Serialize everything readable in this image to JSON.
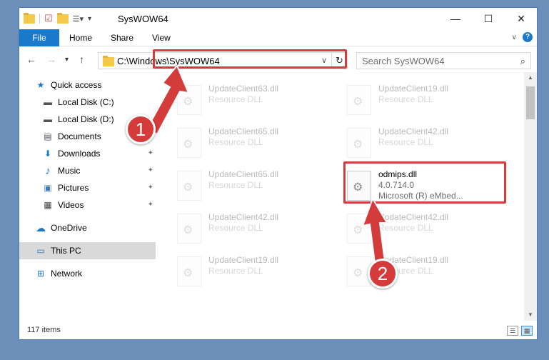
{
  "window": {
    "title": "SysWOW64",
    "minimize": "—",
    "maximize": "☐",
    "close": "✕"
  },
  "ribbon": {
    "tabs": [
      "File",
      "Home",
      "Share",
      "View"
    ],
    "expand_icon": "chevron-down-icon",
    "help": "?"
  },
  "nav": {
    "back": "←",
    "forward": "→",
    "recent": "▾",
    "up": "↑",
    "address": "C:\\Windows\\SysWOW64",
    "address_dropdown": "∨",
    "refresh": "↻",
    "search_placeholder": "Search SysWOW64",
    "search_icon": "⌕"
  },
  "sidebar": {
    "items": [
      {
        "label": "Quick access",
        "icon": "star-icon",
        "glyph": "★",
        "color": "#1979ca"
      },
      {
        "label": "Local Disk (C:)",
        "icon": "drive-icon",
        "glyph": "▬",
        "color": "#555"
      },
      {
        "label": "Local Disk (D:)",
        "icon": "drive-icon",
        "glyph": "▬",
        "color": "#555"
      },
      {
        "label": "Documents",
        "icon": "documents-icon",
        "glyph": "▤",
        "color": "#556"
      },
      {
        "label": "Downloads",
        "icon": "download-icon",
        "glyph": "⬇",
        "color": "#1979ca"
      },
      {
        "label": "Music",
        "icon": "music-icon",
        "glyph": "♪",
        "color": "#1979ca"
      },
      {
        "label": "Pictures",
        "icon": "pictures-icon",
        "glyph": "▣",
        "color": "#3a7bbf"
      },
      {
        "label": "Videos",
        "icon": "videos-icon",
        "glyph": "▦",
        "color": "#444"
      },
      {
        "label": "OneDrive",
        "icon": "cloud-icon",
        "glyph": "☁",
        "color": "#1979ca"
      },
      {
        "label": "This PC",
        "icon": "computer-icon",
        "glyph": "▭",
        "color": "#1979ca"
      },
      {
        "label": "Network",
        "icon": "network-icon",
        "glyph": "⊞",
        "color": "#1979ca"
      }
    ],
    "pin_glyph": "📌"
  },
  "files": [
    {
      "name": "UpdateClient63.dll",
      "desc": "Resource DLL"
    },
    {
      "name": "UpdateClient19.dll",
      "desc": "Resource DLL"
    },
    {
      "name": "UpdateClient65.dll",
      "desc": "Resource DLL"
    },
    {
      "name": "UpdateClient42.dll",
      "desc": "Resource DLL"
    },
    {
      "name": "UpdateClient65.dll",
      "desc": "Resource DLL"
    },
    {
      "name": "UpdateClient42.dll",
      "desc": "Resource DLL"
    },
    {
      "name": "UpdateClient42.dll",
      "desc": "Resource DLL"
    },
    {
      "name": "UpdateClient19.dll",
      "desc": "Resource DLL"
    },
    {
      "name": "UpdateClient19.dll",
      "desc": "Resource DLL"
    }
  ],
  "selected_file": {
    "name": "odmips.dll",
    "version": "4.0.714.0",
    "desc": "Microsoft (R) eMbed..."
  },
  "status": {
    "item_count": "117 items"
  },
  "callouts": {
    "one": "1",
    "two": "2",
    "color": "#d43b3b"
  }
}
